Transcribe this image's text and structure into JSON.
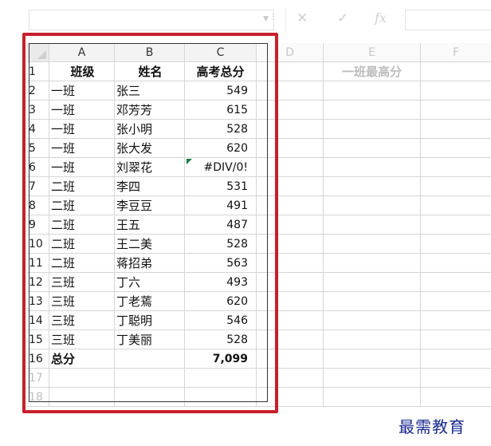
{
  "formula_bar": {
    "cancel_icon": "✕",
    "enter_icon": "✓",
    "fx_label": "fx"
  },
  "columns": [
    "A",
    "B",
    "C",
    "D",
    "E",
    "F"
  ],
  "header_row": {
    "row": "1",
    "a": "班级",
    "b": "姓名",
    "c": "高考总分",
    "e": "一班最高分"
  },
  "rows": [
    {
      "row": "2",
      "a": "一班",
      "b": "张三",
      "c": "549"
    },
    {
      "row": "3",
      "a": "一班",
      "b": "邓芳芳",
      "c": "615"
    },
    {
      "row": "4",
      "a": "一班",
      "b": "张小明",
      "c": "528"
    },
    {
      "row": "5",
      "a": "一班",
      "b": "张大发",
      "c": "620"
    },
    {
      "row": "6",
      "a": "一班",
      "b": "刘翠花",
      "c": "#DIV/0!"
    },
    {
      "row": "7",
      "a": "二班",
      "b": "李四",
      "c": "531"
    },
    {
      "row": "8",
      "a": "二班",
      "b": "李豆豆",
      "c": "491"
    },
    {
      "row": "9",
      "a": "二班",
      "b": "王五",
      "c": "487"
    },
    {
      "row": "10",
      "a": "二班",
      "b": "王二美",
      "c": "528"
    },
    {
      "row": "11",
      "a": "二班",
      "b": "蒋招弟",
      "c": "563"
    },
    {
      "row": "12",
      "a": "三班",
      "b": "丁六",
      "c": "493"
    },
    {
      "row": "13",
      "a": "三班",
      "b": "丁老蔫",
      "c": "620"
    },
    {
      "row": "14",
      "a": "三班",
      "b": "丁聪明",
      "c": "546"
    },
    {
      "row": "15",
      "a": "三班",
      "b": "丁美丽",
      "c": "528"
    }
  ],
  "total_row": {
    "row": "16",
    "a": "总分",
    "c": "7,099"
  },
  "extra_rows": [
    "17",
    "18"
  ],
  "watermark": "最需教育",
  "colors": {
    "highlight": "#c8202c",
    "error_flag": "#1e7d3a",
    "watermark": "#1a2b8f"
  }
}
